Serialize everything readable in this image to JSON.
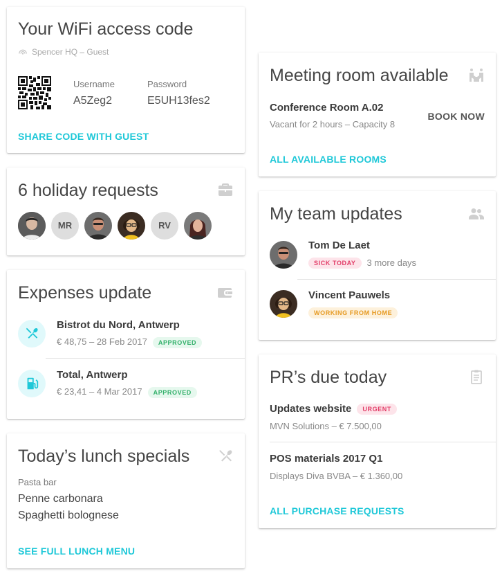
{
  "wifi": {
    "title": "Your WiFi access code",
    "network": "Spencer HQ – Guest",
    "username_label": "Username",
    "username": "A5Zeg2",
    "password_label": "Password",
    "password": "E5UH13fes2",
    "share_link": "SHARE CODE WITH GUEST"
  },
  "holiday": {
    "title": "6 holiday requests",
    "avatars": [
      "",
      "MR",
      "",
      "",
      "RV",
      ""
    ]
  },
  "expenses": {
    "title": "Expenses update",
    "items": [
      {
        "name": "Bistrot du Nord, Antwerp",
        "detail": "€ 48,75 – 28 Feb 2017",
        "status": "APPROVED"
      },
      {
        "name": "Total, Antwerp",
        "detail": "€ 23,41 – 4 Mar 2017",
        "status": "APPROVED"
      }
    ]
  },
  "lunch": {
    "title": "Today’s lunch specials",
    "category": "Pasta bar",
    "dishes": [
      "Penne carbonara",
      "Spaghetti bolognese"
    ],
    "link": "SEE FULL LUNCH MENU"
  },
  "meeting": {
    "title": "Meeting room available",
    "room": "Conference Room A.02",
    "detail": "Vacant for 2 hours – Capacity 8",
    "book": "BOOK NOW",
    "link": "ALL AVAILABLE ROOMS"
  },
  "team": {
    "title": "My team updates",
    "members": [
      {
        "name": "Tom De Laet",
        "status": "SICK TODAY",
        "extra": "3 more days"
      },
      {
        "name": "Vincent Pauwels",
        "status": "WORKING FROM HOME",
        "extra": ""
      }
    ]
  },
  "pr": {
    "title": "PR’s due today",
    "items": [
      {
        "name": "Updates website",
        "badge": "URGENT",
        "detail": "MVN Solutions – € 7.500,00"
      },
      {
        "name": "POS materials 2017 Q1",
        "badge": "",
        "detail": "Displays Diva BVBA – € 1.360,00"
      }
    ],
    "link": "ALL PURCHASE REQUESTS"
  },
  "colors": {
    "accent": "#1fc8d8",
    "approved": "#32b06a",
    "urgent": "#e23c67",
    "wfh": "#e69a22"
  }
}
